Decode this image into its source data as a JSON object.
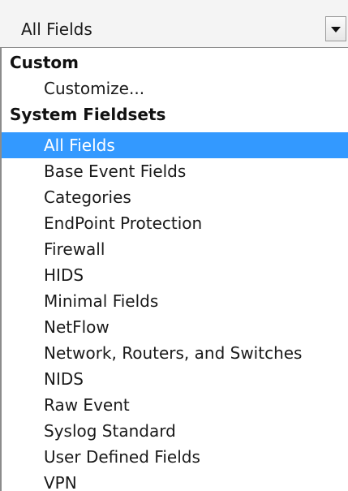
{
  "select": {
    "value": "All Fields",
    "arrow_icon": "caret-down-icon"
  },
  "list": {
    "groups": [
      {
        "label": "Custom",
        "options": [
          "Customize..."
        ]
      },
      {
        "label": "System Fieldsets",
        "options": [
          "All Fields",
          "Base Event Fields",
          "Categories",
          "EndPoint Protection",
          "Firewall",
          "HIDS",
          "Minimal Fields",
          "NetFlow",
          "Network, Routers, and Switches",
          "NIDS",
          "Raw Event",
          "Syslog Standard",
          "User Defined Fields",
          "VPN"
        ]
      }
    ],
    "selected_option": "All Fields"
  },
  "colors": {
    "selection": "#3399ff",
    "selection_text": "#ffffff"
  }
}
